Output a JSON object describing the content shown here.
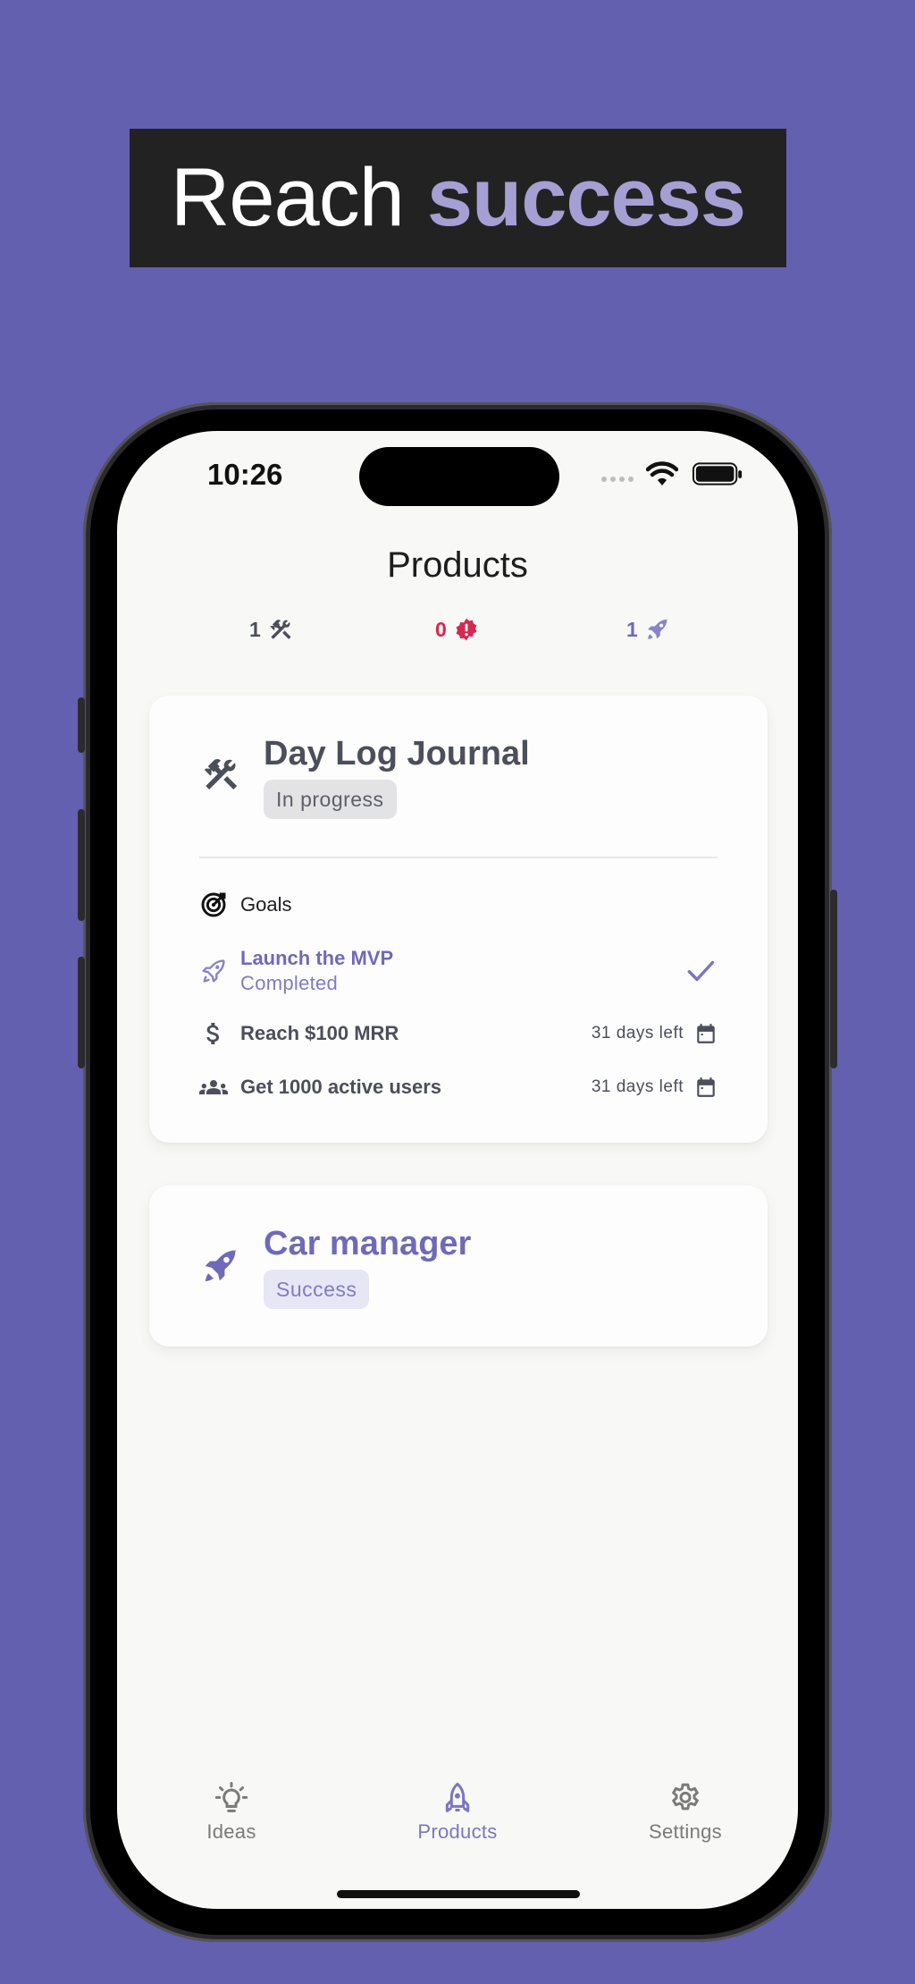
{
  "headline": {
    "lead": "Reach",
    "accent": "success"
  },
  "status_bar": {
    "time": "10:26"
  },
  "header": {
    "title": "Products"
  },
  "counters": [
    {
      "value": "1",
      "icon": "hammer-wrench-icon",
      "color": "#4b4f5a"
    },
    {
      "value": "0",
      "icon": "alert-badge-icon",
      "color": "#d7284f"
    },
    {
      "value": "1",
      "icon": "rocket-icon",
      "color": "#6e6ab8"
    }
  ],
  "products": [
    {
      "name": "Day Log Journal",
      "status": "In progress",
      "icon": "hammer-wrench-icon",
      "goals_label": "Goals",
      "goals": [
        {
          "title": "Launch the MVP",
          "subtitle": "Completed",
          "icon": "rocket-icon",
          "done": true
        },
        {
          "title": "Reach $100 MRR",
          "deadline": "31 days left",
          "icon": "dollar-icon"
        },
        {
          "title": "Get 1000 active users",
          "deadline": "31 days left",
          "icon": "users-icon"
        }
      ]
    },
    {
      "name": "Car manager",
      "status": "Success",
      "icon": "rocket-icon"
    }
  ],
  "tabs": [
    {
      "label": "Ideas",
      "icon": "lightbulb-icon",
      "active": false
    },
    {
      "label": "Products",
      "icon": "rocket-icon",
      "active": true
    },
    {
      "label": "Settings",
      "icon": "gear-icon",
      "active": false
    }
  ],
  "colors": {
    "background": "#6360b0",
    "accent": "#6e6ab8",
    "danger": "#d7284f",
    "text": "#4b4f5a"
  }
}
